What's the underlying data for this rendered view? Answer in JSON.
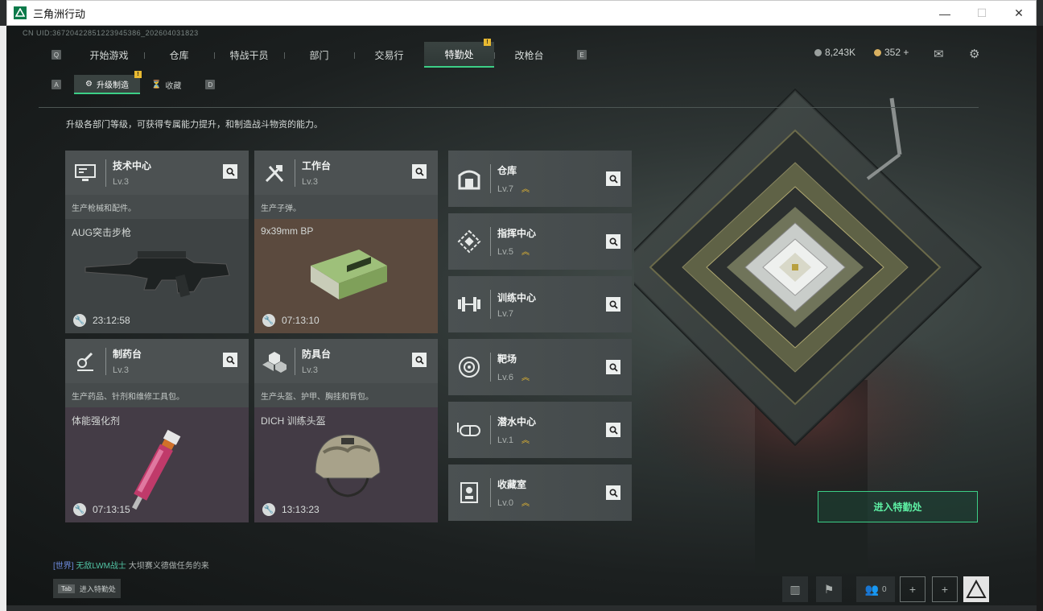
{
  "window": {
    "title": "三角洲行动"
  },
  "uid": "CN UID:36720422851223945386_202604031823",
  "nav": {
    "left_key": "Q",
    "right_key": "E",
    "tabs": [
      "开始游戏",
      "仓库",
      "特战干员",
      "部门",
      "交易行",
      "特勤处",
      "改枪台"
    ],
    "active_tab": "特勤处",
    "active_badge": "!"
  },
  "currency": [
    {
      "icon": "silver-coin-icon",
      "value": "8,243K"
    },
    {
      "icon": "gold-coin-icon",
      "value": "352 +"
    }
  ],
  "subnav": {
    "left_key": "A",
    "right_key": "D",
    "tabs": [
      {
        "label": "升级制造",
        "icon": "upgrade-icon",
        "active": true,
        "badge": "!"
      },
      {
        "label": "收藏",
        "icon": "collection-icon",
        "active": false
      }
    ]
  },
  "description": "升级各部门等级，可获得专属能力提升，和制造战斗物资的能力。",
  "workshops": [
    {
      "name": "技术中心",
      "level": "Lv.3",
      "desc": "生产枪械和配件。",
      "item": "AUG突击步枪",
      "timer": "23:12:58",
      "icon": "tech-center-icon",
      "bg": "#3e4344"
    },
    {
      "name": "工作台",
      "level": "Lv.3",
      "desc": "生产子弹。",
      "item": "9x39mm BP",
      "timer": "07:13:10",
      "icon": "workbench-icon",
      "bg": "#5b4a3e"
    },
    {
      "name": "制药台",
      "level": "Lv.3",
      "desc": "生产药品、针剂和维修工具包。",
      "item": "体能强化剂",
      "timer": "07:13:15",
      "icon": "pharmacy-icon",
      "bg": "#443c46"
    },
    {
      "name": "防具台",
      "level": "Lv.3",
      "desc": "生产头盔、护甲、胸挂和背包。",
      "item": "DICH 训练头盔",
      "timer": "13:13:23",
      "icon": "armor-bench-icon",
      "bg": "#433b45"
    }
  ],
  "facilities": [
    {
      "name": "仓库",
      "level": "Lv.7",
      "upgradable": true,
      "icon": "warehouse-icon"
    },
    {
      "name": "指挥中心",
      "level": "Lv.5",
      "upgradable": true,
      "icon": "command-center-icon"
    },
    {
      "name": "训练中心",
      "level": "Lv.7",
      "upgradable": false,
      "icon": "training-center-icon"
    },
    {
      "name": "靶场",
      "level": "Lv.6",
      "upgradable": true,
      "icon": "shooting-range-icon"
    },
    {
      "name": "潜水中心",
      "level": "Lv.1",
      "upgradable": true,
      "icon": "diving-center-icon"
    },
    {
      "name": "收藏室",
      "level": "Lv.0",
      "upgradable": true,
      "icon": "collection-room-icon"
    }
  ],
  "enter_button": "进入特勤处",
  "chat": {
    "channel": "[世界]",
    "user": "无敌LWM战士",
    "message": "大坝赛义德做任务的来"
  },
  "tab_hint": {
    "key": "Tab",
    "label": "进入特勤处"
  },
  "bottom": {
    "friends_count": "0"
  },
  "colors": {
    "accent": "#3ccf86",
    "badge": "#e8b931",
    "card": "#4c5152"
  }
}
